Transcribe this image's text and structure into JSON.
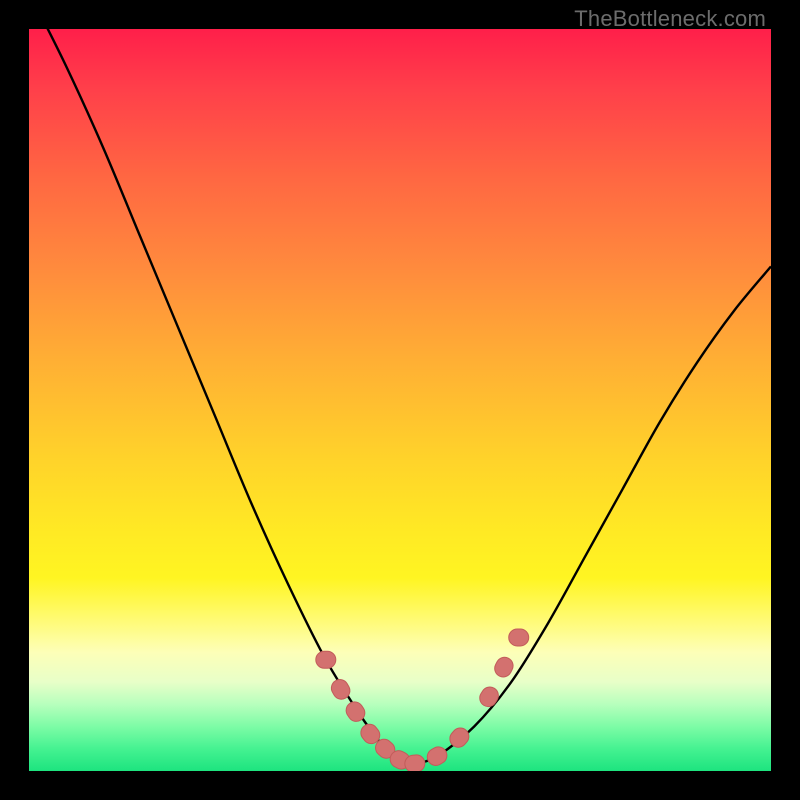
{
  "watermark": "TheBottleneck.com",
  "chart_data": {
    "type": "line",
    "title": "",
    "xlabel": "",
    "ylabel": "",
    "xlim": [
      0,
      100
    ],
    "ylim": [
      0,
      100
    ],
    "grid": false,
    "legend": false,
    "background": "rainbow-gradient",
    "series": [
      {
        "name": "curve",
        "x": [
          0,
          5,
          10,
          15,
          20,
          25,
          30,
          35,
          40,
          45,
          48,
          50,
          52,
          55,
          60,
          65,
          70,
          75,
          80,
          85,
          90,
          95,
          100
        ],
        "y": [
          105,
          95,
          84,
          72,
          60,
          48,
          36,
          25,
          15,
          7,
          3,
          1,
          1,
          2,
          6,
          12,
          20,
          29,
          38,
          47,
          55,
          62,
          68
        ]
      }
    ],
    "markers": {
      "name": "highlighted-points",
      "color": "#d3716f",
      "shape": "rounded-square",
      "points": [
        {
          "x": 40,
          "y": 15
        },
        {
          "x": 42,
          "y": 11
        },
        {
          "x": 44,
          "y": 8
        },
        {
          "x": 46,
          "y": 5
        },
        {
          "x": 48,
          "y": 3
        },
        {
          "x": 50,
          "y": 1.5
        },
        {
          "x": 52,
          "y": 1
        },
        {
          "x": 55,
          "y": 2
        },
        {
          "x": 58,
          "y": 4.5
        },
        {
          "x": 62,
          "y": 10
        },
        {
          "x": 64,
          "y": 14
        },
        {
          "x": 66,
          "y": 18
        }
      ]
    }
  }
}
